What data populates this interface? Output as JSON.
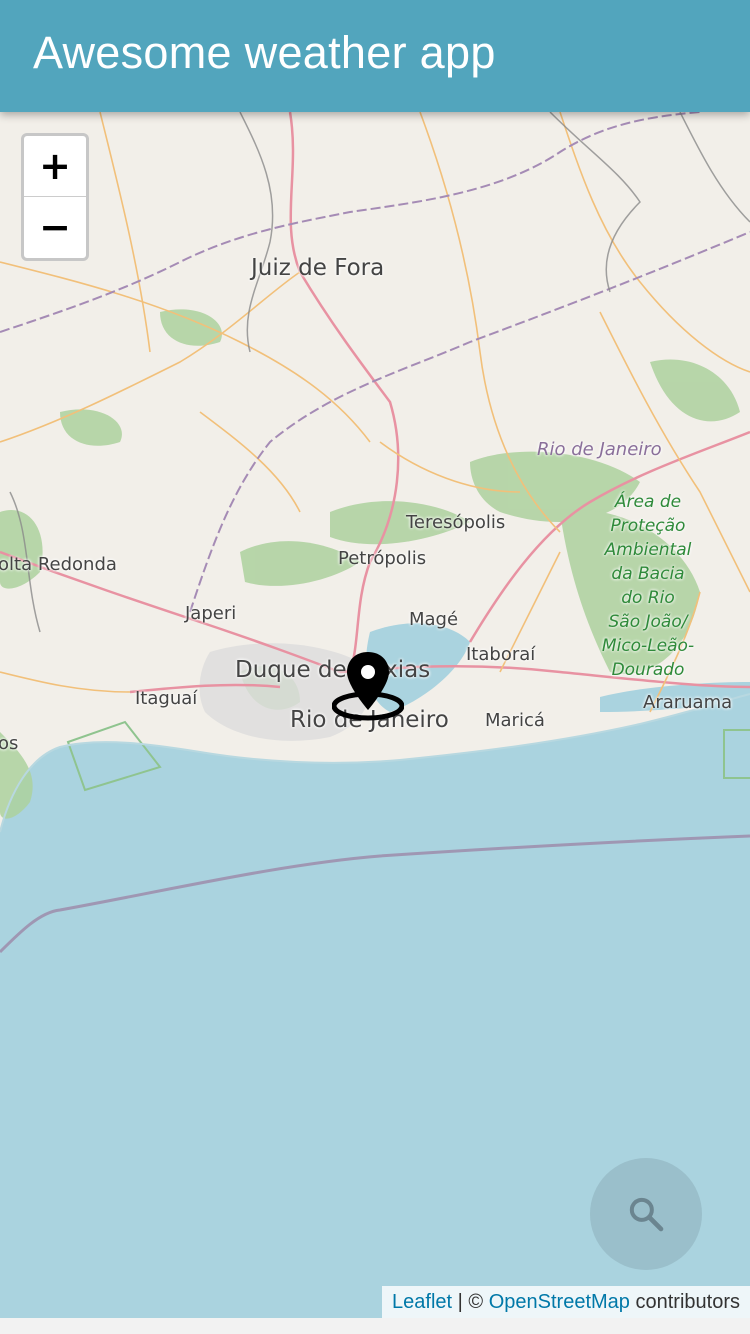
{
  "header": {
    "title": "Awesome weather app"
  },
  "zoom": {
    "in_label": "+",
    "out_label": "−"
  },
  "map": {
    "places": [
      {
        "name": "Juiz de Fora",
        "kind": "city"
      },
      {
        "name": "Rio de Janeiro",
        "kind": "state"
      },
      {
        "name": "Teresópolis",
        "kind": "town"
      },
      {
        "name": "Petrópolis",
        "kind": "town"
      },
      {
        "name": "olta Redonda",
        "kind": "town"
      },
      {
        "name": "Japeri",
        "kind": "town"
      },
      {
        "name": "Magé",
        "kind": "town"
      },
      {
        "name": "Itaboraí",
        "kind": "town"
      },
      {
        "name": "Duque de Caxias",
        "kind": "city"
      },
      {
        "name": "Itaguaí",
        "kind": "town"
      },
      {
        "name": "Rio de Janeiro",
        "kind": "city"
      },
      {
        "name": "Maricá",
        "kind": "town"
      },
      {
        "name": "Araruama",
        "kind": "town"
      },
      {
        "name": "os",
        "kind": "town"
      }
    ],
    "park": {
      "lines": [
        "Área de",
        "Proteção",
        "Ambiental",
        "da Bacia",
        "do Rio",
        "São João/",
        "Mico-Leão-",
        "Dourado"
      ]
    },
    "marker_icon": "map-pin-icon"
  },
  "fab": {
    "icon": "search-icon"
  },
  "attribution": {
    "leaflet": "Leaflet",
    "separator": "| ©",
    "osm": "OpenStreetMap",
    "suffix": "contributors"
  },
  "colors": {
    "appbar": "#52a5bd",
    "water": "#aad3df",
    "land": "#f2efe9",
    "forest": "#add19e",
    "link": "#0078a8"
  }
}
